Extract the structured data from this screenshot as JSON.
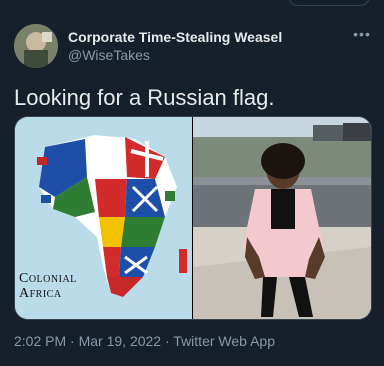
{
  "tweet": {
    "display_name": "Corporate Time-Stealing Weasel",
    "handle": "@WiseTakes",
    "text": "Looking for a Russian flag.",
    "more_icon": "more-horizontal-icon"
  },
  "media": {
    "left_caption_line1": "Colonial",
    "left_caption_line2": "Africa"
  },
  "meta": {
    "time": "2:02 PM",
    "separator": " · ",
    "date": "Mar 19, 2022",
    "source": "Twitter Web App"
  },
  "colors": {
    "background": "#15202b",
    "text_primary": "#e7e9ea",
    "text_secondary": "#8b98a5",
    "border": "#38444d"
  }
}
